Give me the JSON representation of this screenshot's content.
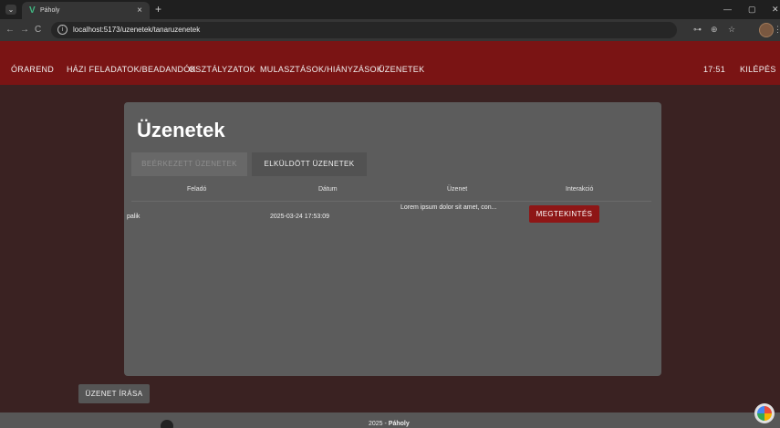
{
  "browser": {
    "tab_title": "Páholy",
    "tab_favicon": "V",
    "close_glyph": "×",
    "new_tab_glyph": "+",
    "tab_switch_glyph": "⌄",
    "url": "localhost:5173/uzenetek/tanaruzenetek",
    "window_min": "—",
    "window_max": "▢",
    "window_close": "✕",
    "nav_back": "←",
    "nav_forward": "→",
    "nav_reload": "C",
    "addr_icons": [
      "⊶",
      "⊕",
      "☆",
      "⋮"
    ]
  },
  "navbar": {
    "items": [
      "ÓRAREND",
      "HÁZI FELADATOK/BEADANDÓK",
      "OSZTÁLYZATOK",
      "MULASZTÁSOK/HIÁNYZÁSOK",
      "ÜZENETEK"
    ],
    "time": "17:51",
    "logout": "KILÉPÉS"
  },
  "page": {
    "title": "Üzenetek",
    "tabs": {
      "inbox": "BEÉRKEZETT ÜZENETEK",
      "sent": "ELKÜLDÖTT ÜZENETEK"
    },
    "table": {
      "headers": [
        "Feladó",
        "Dátum",
        "Üzenet",
        "Interakció"
      ],
      "rows": [
        {
          "sender": "palik",
          "date": "2025-03-24 17:53:09",
          "message": "Lorem ipsum dolor sit amet, con...",
          "action": "MEGTEKINTÉS"
        }
      ]
    },
    "write_button": "ÜZENET ÍRÁSA"
  },
  "footer": {
    "prefix": "2025 - ",
    "brand": "Páholy"
  },
  "colors": {
    "navbar": "#7a1414",
    "background": "#3a2222",
    "card": "#5c5c5c",
    "accent_button": "#8e1616"
  }
}
